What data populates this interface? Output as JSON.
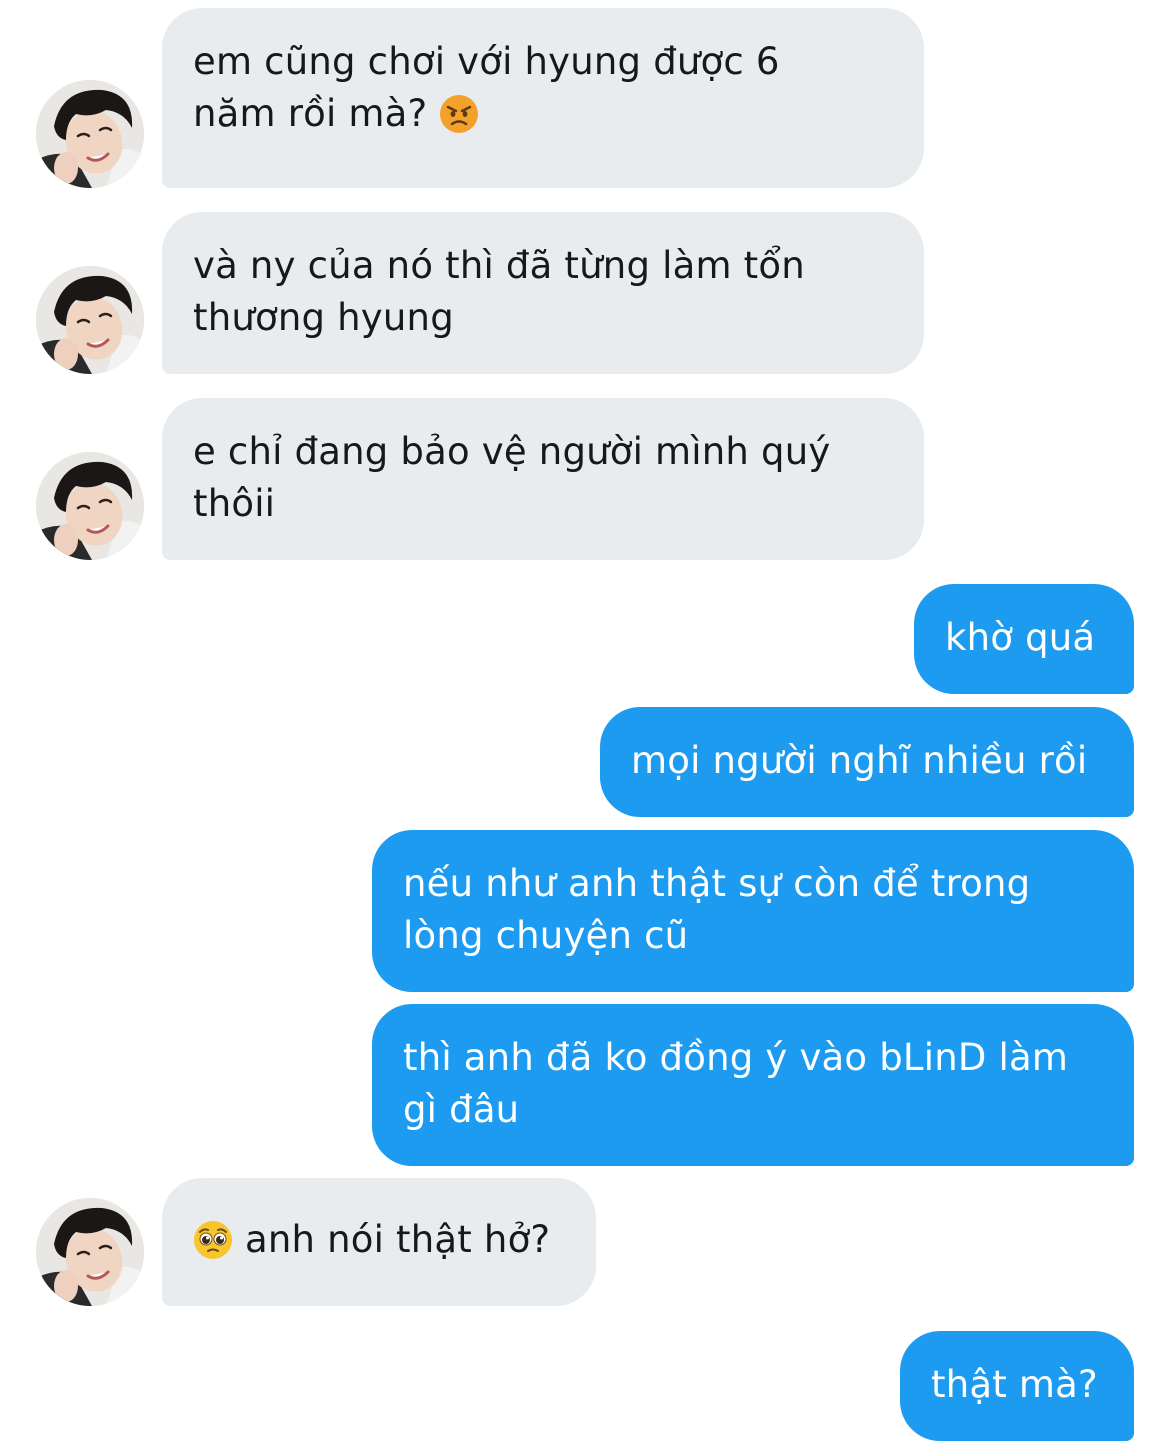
{
  "conversation": {
    "messages": [
      {
        "sender": "them",
        "lines": [
          "em cũng chơi với hyung được 6",
          "năm rồi mà?"
        ],
        "emoji": "angry-face-emoji"
      },
      {
        "sender": "them",
        "lines": [
          "và ny của nó thì đã từng làm tổn",
          "thương hyung"
        ]
      },
      {
        "sender": "them",
        "lines": [
          "e chỉ đang bảo vệ người mình quý",
          "thôii"
        ]
      },
      {
        "sender": "me",
        "lines": [
          "khờ quá"
        ]
      },
      {
        "sender": "me",
        "lines": [
          "mọi người nghĩ nhiều rồi"
        ]
      },
      {
        "sender": "me",
        "lines": [
          "nếu như anh thật sự còn để trong",
          "lòng chuyện cũ"
        ]
      },
      {
        "sender": "me",
        "lines": [
          "thì anh đã ko đồng ý vào bLinD làm",
          "gì đâu"
        ]
      },
      {
        "sender": "them",
        "lines": [
          "anh nói thật hở?"
        ],
        "emoji": "pleading-face-emoji"
      },
      {
        "sender": "me",
        "lines": [
          "thật mà?"
        ]
      }
    ]
  },
  "colors": {
    "incoming_bubble": "#e8ecef",
    "outgoing_bubble": "#1d9bf0",
    "incoming_text": "#15191e",
    "outgoing_text": "#ffffff"
  }
}
